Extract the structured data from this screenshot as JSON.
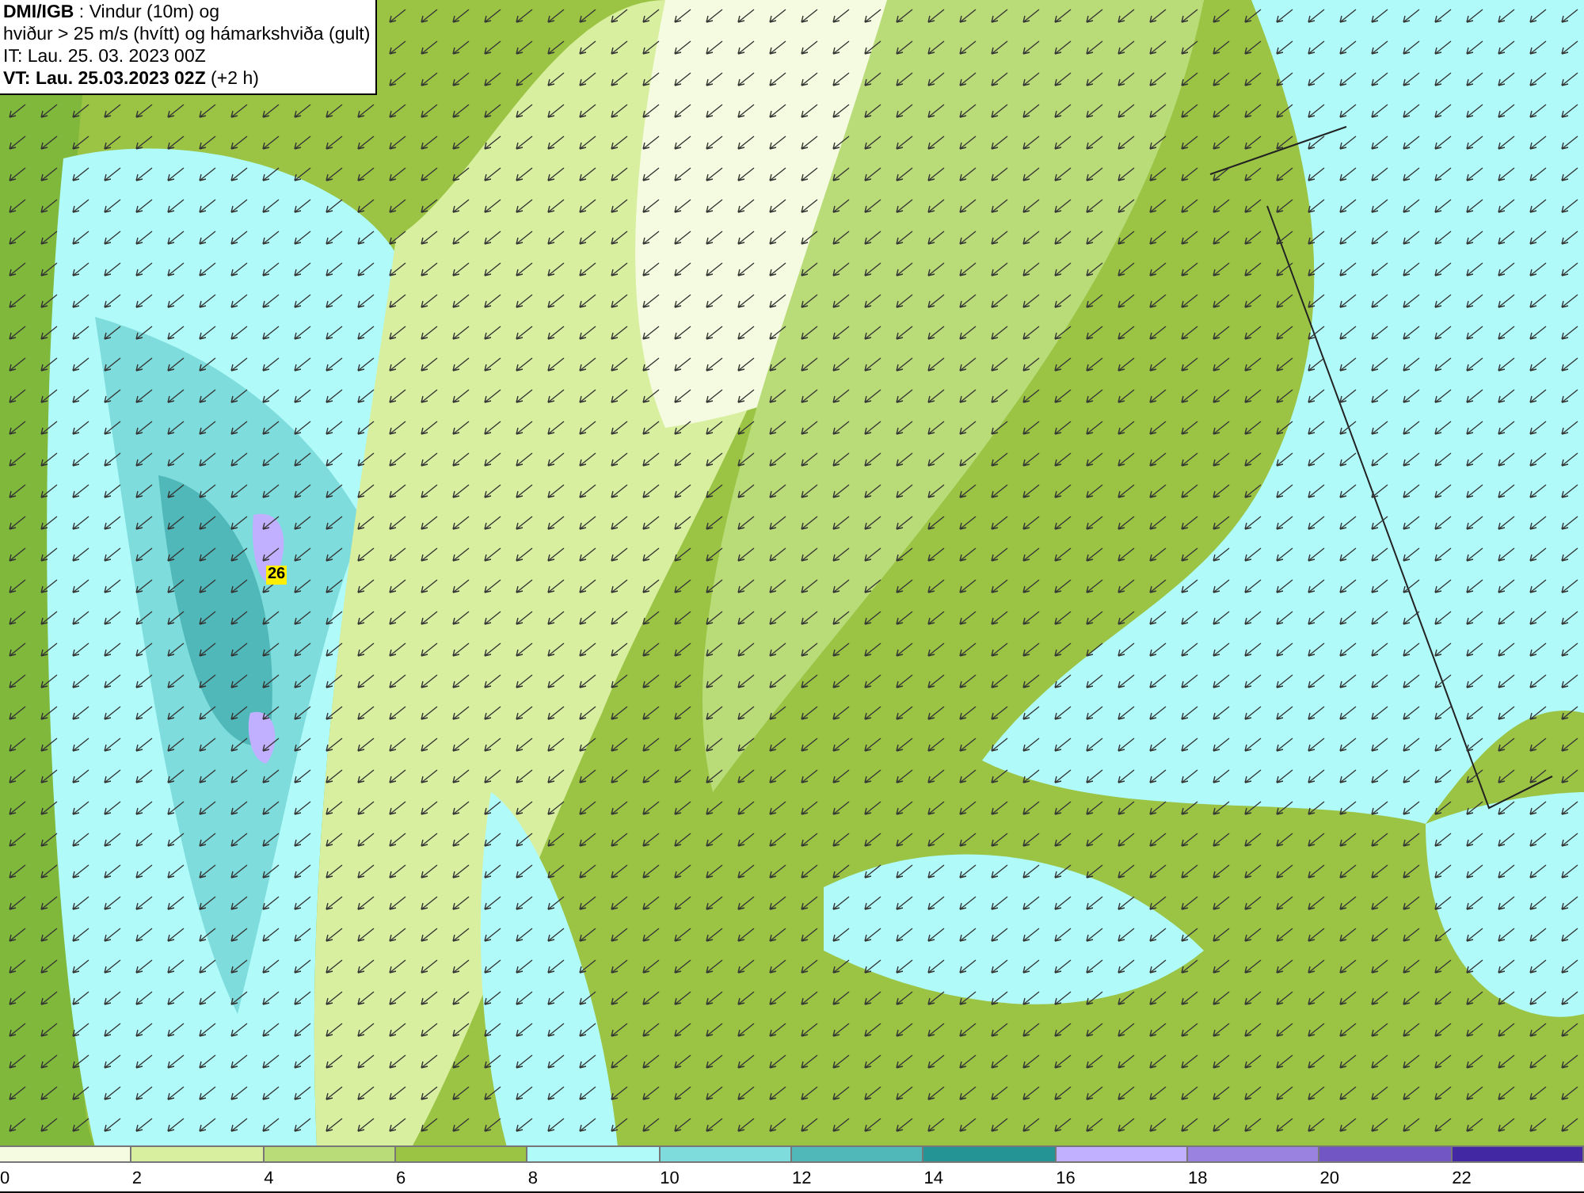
{
  "info_box": {
    "lines": [
      "**DMI/IGB** : Vindur (10m) og",
      "hviður > 25 m/s (hvítt) og hámarkshviða (gult)",
      "IT: Lau. 25. 03. 2023 00Z",
      "**VT: Lau. 25.03.2023 02Z** (+2 h)"
    ]
  },
  "gust_marker": {
    "value": "26"
  },
  "legend": {
    "bins": [
      {
        "label": "0",
        "color": "#f5fbe0"
      },
      {
        "label": "2",
        "color": "#d8efa0"
      },
      {
        "label": "4",
        "color": "#b9dc78"
      },
      {
        "label": "6",
        "color": "#9bc445"
      },
      {
        "label": "8",
        "color": "#b0fafa"
      },
      {
        "label": "10",
        "color": "#7fdcdc"
      },
      {
        "label": "12",
        "color": "#50b8b8"
      },
      {
        "label": "14",
        "color": "#249494"
      },
      {
        "label": "16",
        "color": "#c0b0ff"
      },
      {
        "label": "18",
        "color": "#9a82e0"
      },
      {
        "label": "20",
        "color": "#7256c4"
      },
      {
        "label": "22",
        "color": "#4328a4"
      }
    ]
  }
}
